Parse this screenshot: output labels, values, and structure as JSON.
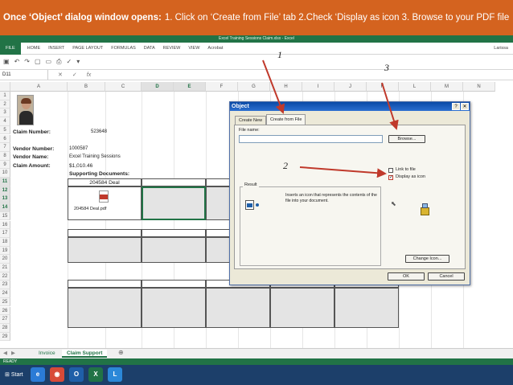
{
  "banner": {
    "lead": "Once ‘Object’ dialog window opens:",
    "steps": "1. Click on ‘Create from File’ tab 2.Check ‘Display as icon 3. Browse to your PDF file"
  },
  "window": {
    "title": "Excel Training Sessions Claim.xlsx - Excel"
  },
  "ribbon": {
    "tabs": [
      "FILE",
      "HOME",
      "INSERT",
      "PAGE LAYOUT",
      "FORMULAS",
      "DATA",
      "REVIEW",
      "VIEW",
      "Acrobat"
    ],
    "user": "Larissa"
  },
  "qat": {
    "icons": [
      "save-icon",
      "undo-icon",
      "redo-icon",
      "new-icon",
      "open-icon",
      "print-icon",
      "spell-icon"
    ]
  },
  "formula_bar": {
    "name_box": "D11",
    "cancel": "✕",
    "enter": "✓",
    "fx": "fx",
    "formula": ""
  },
  "columns": [
    "A",
    "B",
    "C",
    "D",
    "E",
    "F",
    "G",
    "H",
    "I",
    "J",
    "K",
    "L",
    "M",
    "N"
  ],
  "rows": [
    "1",
    "2",
    "3",
    "4",
    "5",
    "6",
    "7",
    "8",
    "9",
    "10",
    "11",
    "12",
    "13",
    "14",
    "15",
    "16",
    "17",
    "18",
    "19",
    "20",
    "21",
    "22",
    "23",
    "24",
    "25",
    "26",
    "27",
    "28",
    "29"
  ],
  "sheet": {
    "claim_number_label": "Claim Number:",
    "claim_number": "523648",
    "vendor_number_label": "Vendor Number:",
    "vendor_number": "1000587",
    "vendor_name_label": "Vendor Name:",
    "vendor_name": "Excel Training Sessions",
    "claim_amount_label": "Claim Amount:",
    "claim_amount": "$1,010.46",
    "supporting_docs_label": "Supporting Documents:",
    "doc_title": "204584 Deal",
    "doc_file": "204584 Deal.pdf"
  },
  "sheet_tabs": [
    "Invoice",
    "Claim Support"
  ],
  "add_sheet": "⊕",
  "status": "READY",
  "taskbar": {
    "start": "Start",
    "apps": [
      {
        "icon": "ie-icon",
        "glyph": "e",
        "color": "#2b7bd6"
      },
      {
        "icon": "chrome-icon",
        "glyph": "◉",
        "color": "#d84a38"
      },
      {
        "icon": "outlook-icon",
        "glyph": "O",
        "color": "#1f5fa8"
      },
      {
        "icon": "excel-icon",
        "glyph": "X",
        "color": "#217346"
      },
      {
        "icon": "lync-icon",
        "glyph": "L",
        "color": "#2b88d8"
      }
    ]
  },
  "dialog": {
    "title": "Object",
    "help": "?",
    "close": "✕",
    "tabs": [
      "Create New",
      "Create from File"
    ],
    "file_name_label": "File name:",
    "file_name_value": "",
    "browse_label": "Browse...",
    "link_to_file_label": "Link to file",
    "link_to_file_checked": false,
    "display_as_icon_label": "Display as icon",
    "display_as_icon_checked": true,
    "check_glyph": "✓",
    "result_label": "Result",
    "result_text": "Inserts an icon that represents the contents of the file into your document.",
    "change_icon_label": "Change Icon...",
    "ok_label": "OK",
    "cancel_label": "Cancel"
  },
  "annotations": {
    "one": "1",
    "two": "2",
    "three": "3"
  },
  "colors": {
    "banner": "#d4631f",
    "excel_green": "#217346",
    "dialog_title": "#0a4aa6",
    "arrow": "#c0392b"
  }
}
